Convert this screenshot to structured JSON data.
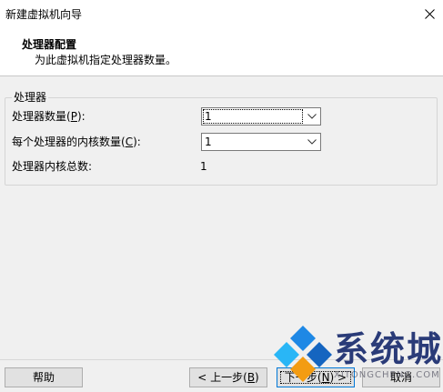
{
  "window": {
    "title": "新建虚拟机向导"
  },
  "header": {
    "title": "处理器配置",
    "subtitle": "为此虚拟机指定处理器数量。"
  },
  "group": {
    "legend": "处理器",
    "processor_count_label": "处理器数量(",
    "processor_count_key": "P",
    "processor_count_suffix": "):",
    "processor_count_value": "1",
    "cores_label": "每个处理器的内核数量(",
    "cores_key": "C",
    "cores_suffix": "):",
    "cores_value": "1",
    "total_label": "处理器内核总数:",
    "total_value": "1"
  },
  "footer": {
    "help_label": "帮助",
    "back_label": "< 上一步(",
    "back_key": "B",
    "back_suffix": ")",
    "next_label": "下一步(",
    "next_key": "N",
    "next_suffix": ") >",
    "cancel_label": "取消"
  },
  "watermark": {
    "text": "系统城",
    "sub": "XITONGCHENG.COM"
  },
  "colors": {
    "accent": "#0078d7",
    "watermark_blue": "#1e88e5",
    "watermark_orange": "#f39c12"
  }
}
